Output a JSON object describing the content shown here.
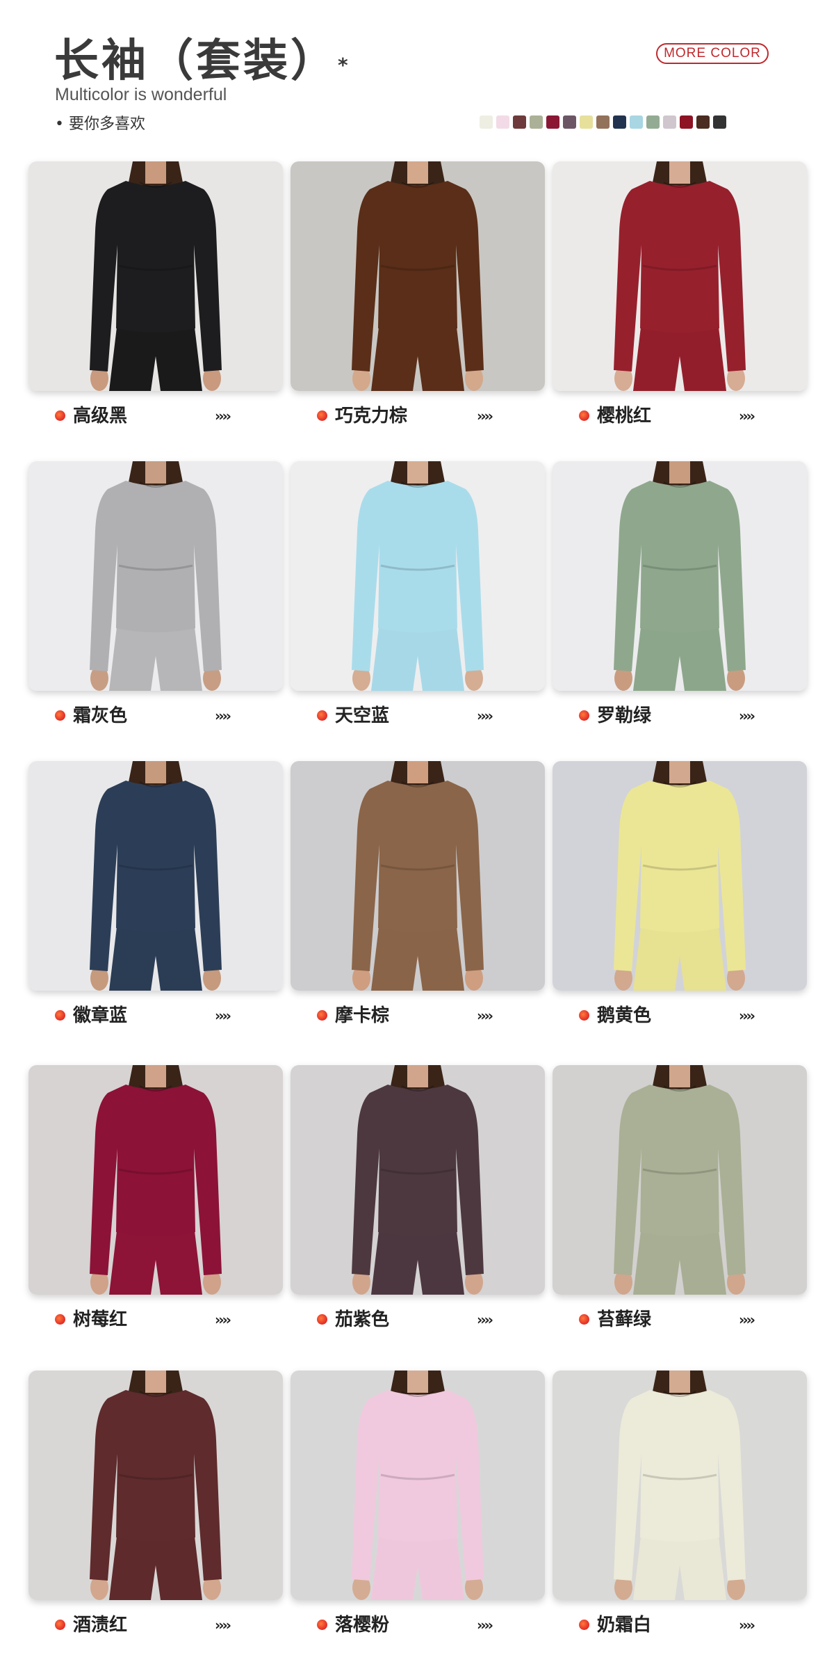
{
  "header": {
    "title": "长袖（套装）",
    "title_star": "*",
    "subtitle": "Multicolor is wonderful",
    "tagline": "• 要你多喜欢",
    "more_color_button": "MORE COLOR",
    "swatch_colors": [
      "#efeee3",
      "#f2dbe6",
      "#6e3a3b",
      "#aab196",
      "#8a1834",
      "#6c5665",
      "#e6e09b",
      "#92725a",
      "#22334f",
      "#a8d6e3",
      "#93ab93",
      "#cfc7cd",
      "#8e1324",
      "#4a2c20",
      "#333333"
    ]
  },
  "products": [
    {
      "name": "高级黑",
      "arrows": "››››",
      "bg": "#e7e6e4",
      "shirt": "#1d1d1f",
      "pants": "#1a1a1a",
      "skin": "#c99a7e"
    },
    {
      "name": "巧克力棕",
      "arrows": "››››",
      "bg": "#c9c7c3",
      "shirt": "#5a2e18",
      "pants": "#5a2e18",
      "skin": "#d3a88b"
    },
    {
      "name": "樱桃红",
      "arrows": "››››",
      "bg": "#eceae9",
      "shirt": "#97202d",
      "pants": "#931e2b",
      "skin": "#d6ac94"
    },
    {
      "name": "霜灰色",
      "arrows": "››››",
      "bg": "#ecebed",
      "shirt": "#b0b0b3",
      "pants": "#b6b6b8",
      "skin": "#c79e83"
    },
    {
      "name": "天空蓝",
      "arrows": "››››",
      "bg": "#eeeeef",
      "shirt": "#a9dceb",
      "pants": "#a7d8e8",
      "skin": "#d5ad92"
    },
    {
      "name": "罗勒绿",
      "arrows": "››››",
      "bg": "#ececee",
      "shirt": "#8fa88d",
      "pants": "#8ca68b",
      "skin": "#c99c80"
    },
    {
      "name": "徽章蓝",
      "arrows": "››››",
      "bg": "#e8e8ea",
      "shirt": "#2c3e57",
      "pants": "#2b3c55",
      "skin": "#c69a7d"
    },
    {
      "name": "摩卡棕",
      "arrows": "››››",
      "bg": "#cdcdcf",
      "shirt": "#8b6549",
      "pants": "#8a6448",
      "skin": "#cf9e80"
    },
    {
      "name": "鹅黄色",
      "arrows": "››››",
      "bg": "#d2d3d8",
      "shirt": "#ebe695",
      "pants": "#e7e192",
      "skin": "#d2a88e"
    },
    {
      "name": "树莓红",
      "arrows": "››››",
      "bg": "#d6d3d2",
      "shirt": "#8c1238",
      "pants": "#8d1337",
      "skin": "#cfa289"
    },
    {
      "name": "茄紫色",
      "arrows": "››››",
      "bg": "#d4d2d2",
      "shirt": "#4d3840",
      "pants": "#4c3740",
      "skin": "#d1a58c"
    },
    {
      "name": "苔藓绿",
      "arrows": "››››",
      "bg": "#d2d1cf",
      "shirt": "#aab095",
      "pants": "#a8ae93",
      "skin": "#d0a68c"
    },
    {
      "name": "酒渍红",
      "arrows": "››››",
      "bg": "#d9d7d6",
      "shirt": "#5f2b2d",
      "pants": "#5e2a2c",
      "skin": "#d2a78d"
    },
    {
      "name": "落樱粉",
      "arrows": "››››",
      "bg": "#d8d7d8",
      "shirt": "#f0c9de",
      "pants": "#efc7dc",
      "skin": "#d4ac93"
    },
    {
      "name": "奶霜白",
      "arrows": "››››",
      "bg": "#d9d9d7",
      "shirt": "#ecead9",
      "pants": "#e9e7d6",
      "skin": "#d3ab91"
    }
  ]
}
